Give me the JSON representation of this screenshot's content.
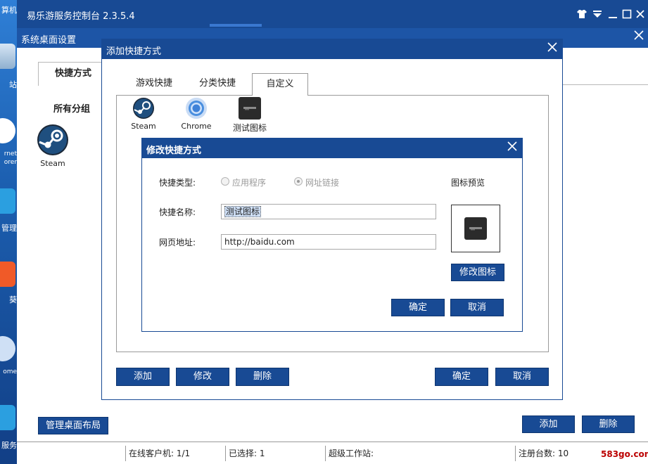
{
  "desktop": {
    "labels": [
      "算机",
      "站",
      "rnet",
      "orer",
      "管理",
      "葵",
      "ome",
      "服务"
    ]
  },
  "app": {
    "title": "易乐游服务控制台 2.3.5.4",
    "controls": [
      "tshirt-icon",
      "dropdown-icon",
      "minimize-icon",
      "maximize-icon",
      "close-icon"
    ]
  },
  "system_settings": {
    "title": "系统桌面设置",
    "tab_shortcut": "快捷方式",
    "group_title": "所有分组",
    "steam_label": "Steam",
    "manage_layout_button": "管理桌面布局",
    "add_button": "添加",
    "delete_button": "删除"
  },
  "add_dialog": {
    "title": "添加快捷方式",
    "tabs": [
      "游戏快捷",
      "分类快捷",
      "自定义"
    ],
    "active_tab": "自定义",
    "items": [
      {
        "label": "Steam",
        "icon": "steam-icon"
      },
      {
        "label": "Chrome",
        "icon": "chrome-icon"
      },
      {
        "label": "测试图标",
        "icon": "test-icon"
      }
    ],
    "buttons": {
      "add": "添加",
      "edit": "修改",
      "delete": "删除",
      "ok": "确定",
      "cancel": "取消"
    }
  },
  "edit_dialog": {
    "title": "修改快捷方式",
    "type_label": "快捷类型:",
    "type_options": [
      {
        "label": "应用程序",
        "selected": false
      },
      {
        "label": "网址链接",
        "selected": true
      }
    ],
    "name_label": "快捷名称:",
    "name_value": "测试图标",
    "url_label": "网页地址:",
    "url_value": "http://baidu.com",
    "preview_label": "图标预览",
    "change_icon_button": "修改图标",
    "ok_button": "确定",
    "cancel_button": "取消"
  },
  "status_bar": {
    "online_clients": "在线客户机: 1/1",
    "selected": "已选择: 1",
    "super_workstation": "超级工作站:",
    "registered": "注册台数: 10",
    "watermark": "583go.com"
  },
  "colors": {
    "primary": "#184a94",
    "header": "#1d55a6",
    "desktop": "#1a5fb4"
  }
}
